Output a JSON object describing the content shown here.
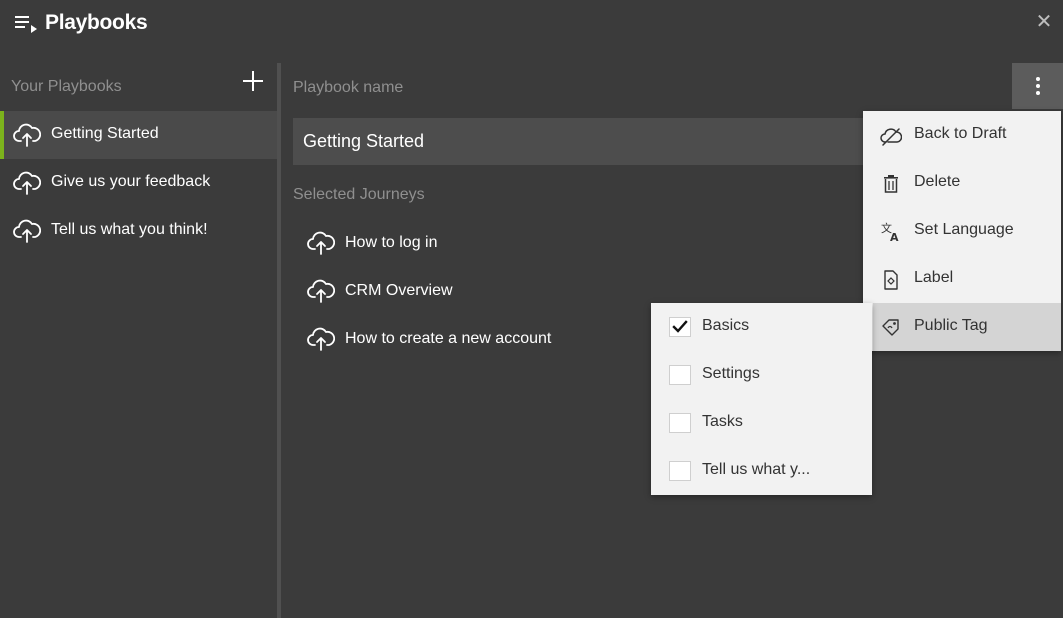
{
  "header": {
    "title": "Playbooks",
    "menu_icon": "playlist-icon",
    "close_glyph": "✕"
  },
  "sidebar": {
    "title": "Your Playbooks",
    "add_icon": "plus-icon",
    "items": [
      {
        "label": "Getting Started",
        "icon": "cloud-upload-icon",
        "active": true
      },
      {
        "label": "Give us your feedback",
        "icon": "cloud-upload-icon",
        "active": false
      },
      {
        "label": "Tell us what you think!",
        "icon": "cloud-upload-icon",
        "active": false
      }
    ]
  },
  "main": {
    "playbook_name_label": "Playbook name",
    "playbook_name_value": "Getting Started",
    "selected_journeys_label": "Selected Journeys",
    "journeys": [
      {
        "label": "How to log in",
        "icon": "cloud-upload-icon"
      },
      {
        "label": "CRM Overview",
        "icon": "cloud-upload-icon"
      },
      {
        "label": "How to create a new account",
        "icon": "cloud-upload-icon"
      }
    ]
  },
  "context_menu": {
    "items": [
      {
        "label": "Back to Draft",
        "icon": "cloud-off-icon"
      },
      {
        "label": "Delete",
        "icon": "trash-icon"
      },
      {
        "label": "Set Language",
        "icon": "translate-icon"
      },
      {
        "label": "Label",
        "icon": "document-icon"
      },
      {
        "label": "Public Tag",
        "icon": "tag-icon",
        "highlighted": true
      }
    ]
  },
  "tag_submenu": {
    "items": [
      {
        "label": "Basics",
        "checked": true
      },
      {
        "label": "Settings",
        "checked": false
      },
      {
        "label": "Tasks",
        "checked": false
      },
      {
        "label": "Tell us what y...",
        "checked": false
      }
    ]
  },
  "colors": {
    "background": "#3b3b3b",
    "active_accent": "#7cb31c",
    "menu_background": "#f2f2f2",
    "menu_highlight": "#d4d4d4"
  }
}
